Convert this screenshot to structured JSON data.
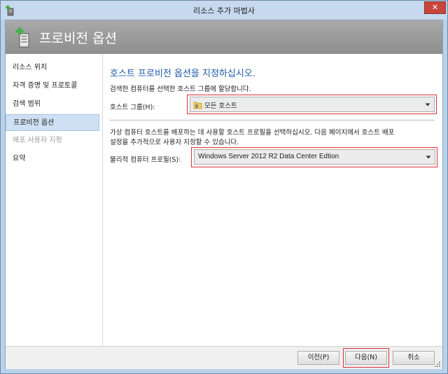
{
  "window": {
    "title": "리소스 추가 마법사",
    "close_label": "✕"
  },
  "header": {
    "title": "프로비전 옵션"
  },
  "nav": {
    "items": [
      {
        "label": "리소스 위치",
        "state": "normal"
      },
      {
        "label": "자격 증명 및 프로토콜",
        "state": "normal"
      },
      {
        "label": "검색 범위",
        "state": "normal"
      },
      {
        "label": "프로비전 옵션",
        "state": "active"
      },
      {
        "label": "배포 사용자 지정",
        "state": "disabled"
      },
      {
        "label": "요약",
        "state": "normal"
      }
    ]
  },
  "main": {
    "section_title": "호스트 프로비전 옵션을 지정하십시오.",
    "host_group_desc": "검색한 컴퓨터를 선택한 호스트 그룹에 할당합니다.",
    "host_group_label": "호스트 그룹(H):",
    "host_group_value": "모든 호스트",
    "profile_desc_line1": "가상 컴퓨터 호스트를 배포하는 데 사용할 호스트 프로필을 선택하십시오. 다음 페이지에서 호스트 배포",
    "profile_desc_line2": "설정을 추가적으로 사용자 지정할 수 있습니다.",
    "profile_label": "물리적 컴퓨터 프로필(S):",
    "profile_value": "Windows Server 2012 R2 Data Center Edtion"
  },
  "footer": {
    "prev_label": "이전(P)",
    "next_label": "다음(N)",
    "cancel_label": "취소"
  },
  "colors": {
    "accent_title": "#1f5aa8",
    "highlight_border": "#e0313a",
    "header_bg": "#999999",
    "active_nav_bg": "#cfe0f4"
  }
}
